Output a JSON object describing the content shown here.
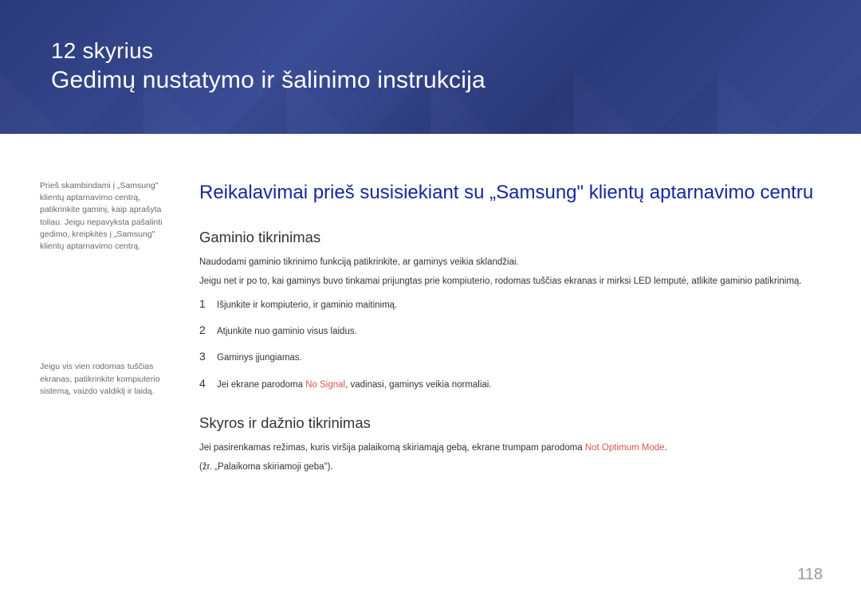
{
  "header": {
    "chapter_label": "12 skyrius",
    "chapter_title": "Gedimų nustatymo ir šalinimo instrukcija"
  },
  "sidebar": {
    "note1": "Prieš skambindami į „Samsung\" klientų aptarnavimo centrą, patikrinkite gaminį, kaip aprašyta toliau. Jeigu nepavyksta pašalinti gedimo, kreipkitės į „Samsung\" klientų aptarnavimo centrą.",
    "note2": "Jeigu vis vien rodomas tuščias ekranas, patikrinkite kompiuterio sistemą, vaizdo valdiklį ir laidą."
  },
  "main": {
    "h2": "Reikalavimai prieš susisiekiant su „Samsung\" klientų aptarnavimo centru",
    "section1": {
      "title": "Gaminio tikrinimas",
      "p1": "Naudodami gaminio tikrinimo funkciją patikrinkite, ar gaminys veikia sklandžiai.",
      "p2": "Jeigu net ir po to, kai gaminys buvo tinkamai prijungtas prie kompiuterio, rodomas tuščias ekranas ir mirksi LED lemputė, atlikite gaminio patikrinimą.",
      "steps": [
        {
          "num": "1",
          "text": "Išjunkite ir kompiuterio, ir gaminio maitinimą."
        },
        {
          "num": "2",
          "text": "Atjunkite nuo gaminio visus laidus."
        },
        {
          "num": "3",
          "text": "Gaminys įjungiamas."
        },
        {
          "num": "4",
          "pre": "Jei ekrane parodoma ",
          "warn": "No Signal",
          "post": ", vadinasi, gaminys veikia normaliai."
        }
      ]
    },
    "section2": {
      "title": "Skyros ir dažnio tikrinimas",
      "p1_pre": "Jei pasirenkamas režimas, kuris viršija palaikomą skiriamąją gebą, ekrane trumpam parodoma ",
      "p1_warn": "Not Optimum Mode",
      "p1_post": ".",
      "p2": "(žr. „Palaikoma skiriamoji geba\")."
    }
  },
  "page_number": "118"
}
